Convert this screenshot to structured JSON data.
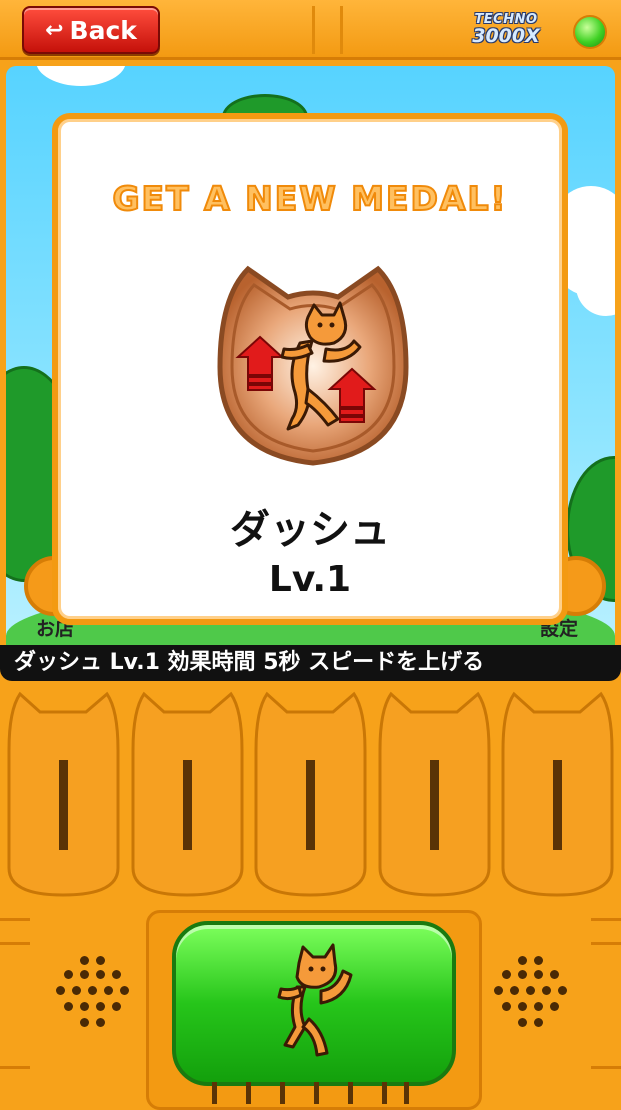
{
  "topbar": {
    "back_label": "Back",
    "brand_line1": "TECHNO",
    "brand_line2": "3000X"
  },
  "screen": {
    "left_label": "お店",
    "right_label": "設定"
  },
  "ticker": {
    "text": "ダッシュ Lv.1  効果時間 5秒  スピードを上げる"
  },
  "popup": {
    "title": "GET A NEW MEDAL!",
    "medal_name": "ダッシュ",
    "medal_level": "Lv.1"
  },
  "colors": {
    "body_orange": "#f7a21a",
    "accent_green": "#26c51a",
    "back_red": "#c5110a",
    "medal_bronze": "#c8703a"
  },
  "icons": {
    "back": "return-arrow-icon",
    "led": "status-led-icon",
    "medal": "cat-dash-medal-icon",
    "go_button": "running-cat-icon"
  }
}
